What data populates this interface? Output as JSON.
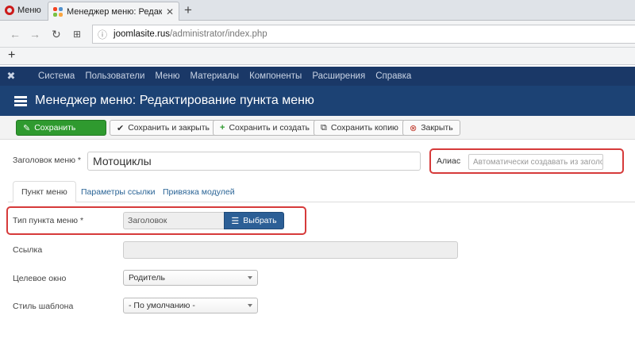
{
  "browser": {
    "menu_label": "Меню",
    "tab_title": "Менеджер меню: Редакти",
    "url_domain": "joomlasite.rus",
    "url_path": "/administrator/index.php"
  },
  "admin_menu": [
    "Система",
    "Пользователи",
    "Меню",
    "Материалы",
    "Компоненты",
    "Расширения",
    "Справка"
  ],
  "page_title": "Менеджер меню: Редактирование пункта меню",
  "toolbar": {
    "save": "Сохранить",
    "save_close": "Сохранить и закрыть",
    "save_new": "Сохранить и создать",
    "save_copy": "Сохранить копию",
    "close": "Закрыть"
  },
  "form": {
    "title_label": "Заголовок меню *",
    "title_value": "Мотоциклы",
    "alias_label": "Алиас",
    "alias_placeholder": "Автоматически создавать из заголовка",
    "tabs": [
      "Пункт меню",
      "Параметры ссылки",
      "Привязка модулей"
    ],
    "type_label": "Тип пункта меню *",
    "type_value": "Заголовок",
    "select_button": "Выбрать",
    "link_label": "Ссылка",
    "link_value": "",
    "target_label": "Целевое окно",
    "target_value": "Родитель",
    "style_label": "Стиль шаблона",
    "style_value": "- По умолчанию -"
  },
  "colors": {
    "joomla_menu_bg": "#1a3867",
    "joomla_title_bg": "#1c4274",
    "save_green": "#2f9a2f",
    "select_blue": "#2c5f96",
    "highlight_red": "#d63a3a"
  }
}
